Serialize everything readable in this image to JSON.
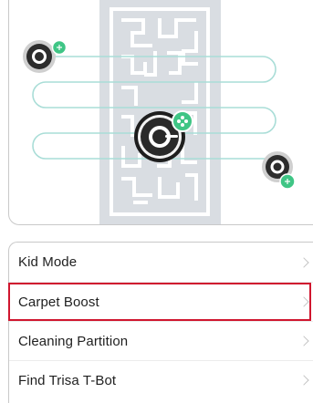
{
  "illustration": {
    "robots": [
      "robot-vacuum-icon",
      "robot-vacuum-icon",
      "robot-vacuum-icon"
    ],
    "badge_icon": "fan-icon",
    "colors": {
      "carpet": "#d9dde2",
      "maze": "#ffffff",
      "path": "#a9ddd7",
      "badge": "#3fc585",
      "robot": "#2c2c2c"
    }
  },
  "settings": {
    "items": [
      {
        "label": "Kid Mode"
      },
      {
        "label": "Carpet Boost",
        "highlighted": true
      },
      {
        "label": "Cleaning Partition"
      },
      {
        "label": "Find Trisa T-Bot"
      }
    ]
  }
}
